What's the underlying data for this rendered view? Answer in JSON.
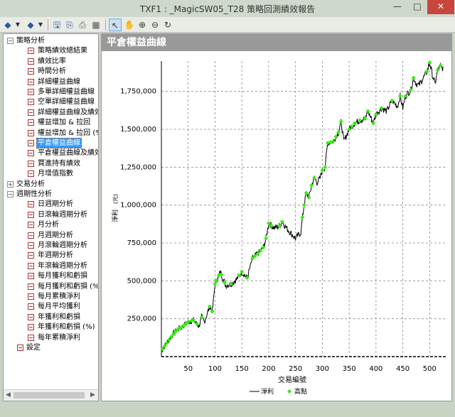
{
  "window": {
    "title": "TXF1 : _MagicSW05_T28 策略回測績效報告",
    "minimize": "—",
    "maximize": "□",
    "close": "✕"
  },
  "toolbar": {
    "icons": [
      "back-icon",
      "dropdown-icon",
      "forward-icon",
      "dropdown-icon",
      "save-icon",
      "export-icon",
      "print-icon",
      "table-icon",
      "pointer-icon",
      "hand-icon",
      "zoom-in-icon",
      "zoom-out-icon",
      "refresh-icon"
    ]
  },
  "tree": {
    "items": [
      {
        "label": "策略分析",
        "level": 0,
        "expand": "⊟"
      },
      {
        "label": "策略績效總結果",
        "level": 1
      },
      {
        "label": "績效比率",
        "level": 1
      },
      {
        "label": "時間分析",
        "level": 1
      },
      {
        "label": "詳細權益曲線",
        "level": 1
      },
      {
        "label": "多單詳細權益曲線",
        "level": 1
      },
      {
        "label": "空單詳細權益曲線",
        "level": 1
      },
      {
        "label": "詳細權益曲線及績效",
        "level": 1
      },
      {
        "label": "權益增加 & 拉回",
        "level": 1
      },
      {
        "label": "權益增加 & 拉回 (%)",
        "level": 1
      },
      {
        "label": "平倉權益曲線",
        "level": 1,
        "selected": true
      },
      {
        "label": "平倉權益曲線及績效",
        "level": 1
      },
      {
        "label": "買進持有績效",
        "level": 1
      },
      {
        "label": "月增值指數",
        "level": 1
      },
      {
        "label": "交易分析",
        "level": 0,
        "expand": "⊞"
      },
      {
        "label": "週期性分析",
        "level": 0,
        "expand": "⊟"
      },
      {
        "label": "日週期分析",
        "level": 1
      },
      {
        "label": "日滾輪週期分析",
        "level": 1
      },
      {
        "label": "月分析",
        "level": 1
      },
      {
        "label": "月週期分析",
        "level": 1
      },
      {
        "label": "月滾輪週期分析",
        "level": 1
      },
      {
        "label": "年週期分析",
        "level": 1
      },
      {
        "label": "年滾輪週期分析",
        "level": 1
      },
      {
        "label": "每月獲利和虧損",
        "level": 1
      },
      {
        "label": "每月獲利和虧損 (%)",
        "level": 1
      },
      {
        "label": "每月累積淨利",
        "level": 1
      },
      {
        "label": "每月平均獲利",
        "level": 1
      },
      {
        "label": "年獲利和虧損",
        "level": 1
      },
      {
        "label": "年獲利和虧損 (%)",
        "level": 1
      },
      {
        "label": "每年累積淨利",
        "level": 1
      },
      {
        "label": "設定",
        "level": 0,
        "expand": ""
      }
    ]
  },
  "panel": {
    "title": "平倉權益曲線"
  },
  "chart_data": {
    "type": "line",
    "xlabel": "交易編號",
    "ylabel": "淨利",
    "y_unit": "(元)",
    "xlim": [
      0,
      530
    ],
    "ylim": [
      0,
      1950000
    ],
    "xticks": [
      50,
      100,
      150,
      200,
      250,
      300,
      350,
      400,
      450,
      500
    ],
    "yticks": [
      250000,
      500000,
      750000,
      1000000,
      1250000,
      1500000,
      1750000
    ],
    "ytick_labels": [
      "250,000",
      "500,000",
      "750,000",
      "1,000,000",
      "1,250,000",
      "1,500,000",
      "1,750,000"
    ],
    "xtick_labels": [
      "50",
      "100",
      "150",
      "200",
      "250",
      "300",
      "350",
      "400",
      "450",
      "500"
    ],
    "legend": {
      "placement": "bottom",
      "items": [
        "淨利",
        "高點"
      ]
    },
    "grid": true,
    "line_color": "#000000",
    "marker_color": "#33ee11",
    "anchors": [
      [
        0,
        40000
      ],
      [
        10,
        90000
      ],
      [
        20,
        140000
      ],
      [
        30,
        180000
      ],
      [
        40,
        200000
      ],
      [
        50,
        230000
      ],
      [
        60,
        240000
      ],
      [
        70,
        200000
      ],
      [
        75,
        260000
      ],
      [
        80,
        230000
      ],
      [
        90,
        330000
      ],
      [
        95,
        300000
      ],
      [
        100,
        480000
      ],
      [
        110,
        560000
      ],
      [
        120,
        470000
      ],
      [
        130,
        480000
      ],
      [
        140,
        510000
      ],
      [
        150,
        560000
      ],
      [
        160,
        520000
      ],
      [
        170,
        650000
      ],
      [
        180,
        680000
      ],
      [
        190,
        720000
      ],
      [
        195,
        780000
      ],
      [
        200,
        880000
      ],
      [
        210,
        850000
      ],
      [
        220,
        860000
      ],
      [
        225,
        890000
      ],
      [
        235,
        840000
      ],
      [
        245,
        800000
      ],
      [
        250,
        780000
      ],
      [
        255,
        800000
      ],
      [
        260,
        820000
      ],
      [
        263,
        920000
      ],
      [
        266,
        1000000
      ],
      [
        270,
        1080000
      ],
      [
        275,
        1050000
      ],
      [
        280,
        1130000
      ],
      [
        285,
        1180000
      ],
      [
        290,
        1150000
      ],
      [
        295,
        1170000
      ],
      [
        300,
        1230000
      ],
      [
        305,
        1250000
      ],
      [
        310,
        1410000
      ],
      [
        320,
        1420000
      ],
      [
        330,
        1480000
      ],
      [
        335,
        1550000
      ],
      [
        340,
        1420000
      ],
      [
        345,
        1460000
      ],
      [
        350,
        1500000
      ],
      [
        360,
        1540000
      ],
      [
        370,
        1560000
      ],
      [
        380,
        1570000
      ],
      [
        385,
        1620000
      ],
      [
        390,
        1580000
      ],
      [
        395,
        1540000
      ],
      [
        400,
        1600000
      ],
      [
        410,
        1640000
      ],
      [
        420,
        1620000
      ],
      [
        430,
        1690000
      ],
      [
        440,
        1650000
      ],
      [
        445,
        1720000
      ],
      [
        450,
        1640000
      ],
      [
        455,
        1720000
      ],
      [
        465,
        1760000
      ],
      [
        470,
        1840000
      ],
      [
        475,
        1800000
      ],
      [
        480,
        1790000
      ],
      [
        490,
        1850000
      ],
      [
        495,
        1880000
      ],
      [
        500,
        1940000
      ],
      [
        505,
        1860000
      ],
      [
        510,
        1800000
      ],
      [
        515,
        1890000
      ],
      [
        520,
        1920000
      ],
      [
        525,
        1900000
      ]
    ],
    "peaks_x": [
      2,
      6,
      10,
      14,
      18,
      22,
      26,
      30,
      34,
      38,
      42,
      46,
      50,
      56,
      60,
      66,
      75,
      90,
      95,
      100,
      103,
      107,
      112,
      118,
      130,
      145,
      150,
      160,
      170,
      175,
      180,
      185,
      190,
      195,
      200,
      205,
      220,
      225,
      263,
      266,
      270,
      275,
      280,
      285,
      300,
      305,
      310,
      315,
      320,
      325,
      330,
      335,
      350,
      355,
      360,
      370,
      380,
      385,
      395,
      400,
      410,
      430,
      445,
      455,
      465,
      470,
      495,
      500,
      515,
      520
    ]
  }
}
